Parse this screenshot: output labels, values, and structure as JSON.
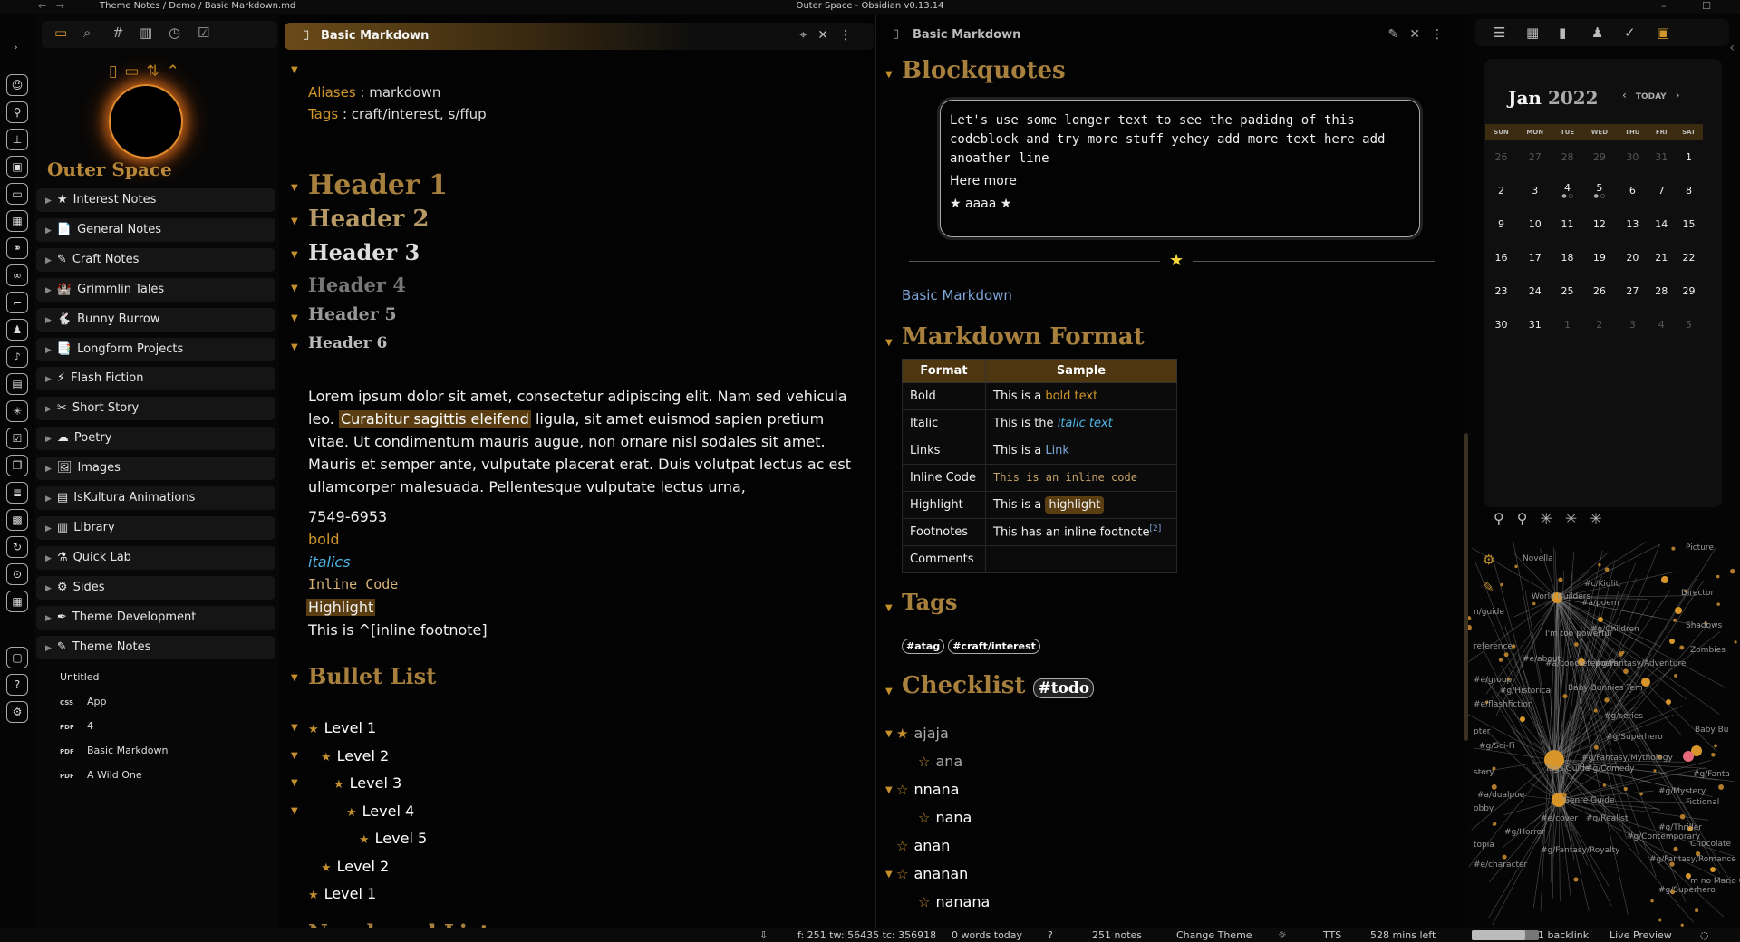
{
  "window": {
    "path": "Theme Notes / Demo / Basic Markdown.md",
    "title": "Outer Space - Obsidian v0.13.14",
    "controls": "– ☐"
  },
  "colors": {
    "accent": "#d0962a",
    "background": "#050505",
    "link": "#7ea6d9"
  },
  "left": {
    "vault_name": "Outer Space",
    "folders": [
      {
        "icon": "★",
        "label": "Interest Notes"
      },
      {
        "icon": "📄",
        "label": "General Notes"
      },
      {
        "icon": "✎",
        "label": "Craft Notes"
      },
      {
        "icon": "🏰",
        "label": "Grimmlin Tales"
      },
      {
        "icon": "🐇",
        "label": "Bunny Burrow"
      },
      {
        "icon": "📑",
        "label": "Longform Projects"
      },
      {
        "icon": "⚡",
        "label": "Flash Fiction"
      },
      {
        "icon": "✂",
        "label": "Short Story"
      },
      {
        "icon": "☁",
        "label": "Poetry"
      },
      {
        "icon": "🖼",
        "label": "Images"
      },
      {
        "icon": "▤",
        "label": "IsKultura Animations"
      },
      {
        "icon": "▥",
        "label": "Library"
      },
      {
        "icon": "⚗",
        "label": "Quick Lab"
      },
      {
        "icon": "⚙",
        "label": "Sides"
      },
      {
        "icon": "✒",
        "label": "Theme Development"
      },
      {
        "icon": "✎",
        "label": "Theme Notes"
      }
    ],
    "files": [
      {
        "badge": "",
        "label": "Untitled"
      },
      {
        "badge": "CSS",
        "label": "App"
      },
      {
        "badge": "PDF",
        "label": "4"
      },
      {
        "badge": "PDF",
        "label": "Basic Markdown"
      },
      {
        "badge": "PDF",
        "label": "A Wild One"
      }
    ]
  },
  "editor": {
    "tab_title": "Basic Markdown",
    "aliases_key": "Aliases",
    "aliases_val": " : markdown",
    "tags_key": "Tags",
    "tags_val": " : craft/interest, s/ffup",
    "headers": [
      "Header 1",
      "Header 2",
      "Header 3",
      "Header 4",
      "Header 5",
      "Header 6"
    ],
    "para_1": "Lorem ipsum dolor sit amet, consectetur adipiscing elit. Nam sed vehicula leo. ",
    "para_hl": "Curabitur sagittis eleifend",
    "para_2": " ligula, sit amet euismod sapien pretium vitae. Ut condimentum mauris augue, non ornare nisl sodales sit amet. Mauris et semper ante, vulputate placerat erat. Duis volutpat lectus ac est ullamcorper malesuada. Pellentesque vulputate lectus urna,",
    "phone": "7549-6953",
    "bold": "bold",
    "italics": "italics",
    "inline_code": "Inline Code",
    "highlight": "Highlight",
    "footnote": "This is ^[inline footnote]",
    "bullet_heading": "Bullet List",
    "bullets": [
      "Level 1",
      "Level 2",
      "Level 3",
      "Level 4",
      "Level 5",
      "Level 2",
      "Level 1"
    ],
    "next_heading": "Numbered List"
  },
  "preview": {
    "tab_title": "Basic Markdown",
    "blockquotes_heading": "Blockquotes",
    "quote_text": "Let's use some longer text to see the padidng of this codeblock and try more stuff yehey add more text here add anoather line",
    "quote_more": "Here more",
    "quote_star": "★ aaaa ★",
    "link_text": "Basic Markdown",
    "format_heading": "Markdown Format",
    "table_headers": [
      "Format",
      "Sample"
    ],
    "table_rows": [
      {
        "format": "Bold",
        "pre": "This is a ",
        "sample": "bold text"
      },
      {
        "format": "Italic",
        "pre": "This is the ",
        "sample": "italic text"
      },
      {
        "format": "Links",
        "pre": "This is a ",
        "sample": "Link"
      },
      {
        "format": "Inline Code",
        "pre": "",
        "sample": "This is an inline code"
      },
      {
        "format": "Highlight",
        "pre": "This is a ",
        "sample": "highlight"
      },
      {
        "format": "Footnotes",
        "pre": "This has an inline footnote",
        "sample": "[2]"
      },
      {
        "format": "Comments",
        "pre": "",
        "sample": ""
      }
    ],
    "tags_heading": "Tags",
    "tags": [
      "#atag",
      "#craft/interest"
    ],
    "checklist_heading": "Checklist",
    "checklist_tag": "#todo",
    "checklist": [
      "ajaja",
      "ana",
      "nnana",
      "nana",
      "anan",
      "ananan",
      "nanana"
    ]
  },
  "calendar": {
    "month": "Jan",
    "year": "2022",
    "today": "TODAY",
    "weekdays": [
      "SUN",
      "MON",
      "TUE",
      "WED",
      "THU",
      "FRI",
      "SAT"
    ],
    "weeks": [
      [
        "26",
        "27",
        "28",
        "29",
        "30",
        "31",
        "1"
      ],
      [
        "2",
        "3",
        "4",
        "5",
        "6",
        "7",
        "8"
      ],
      [
        "9",
        "10",
        "11",
        "12",
        "13",
        "14",
        "15"
      ],
      [
        "16",
        "17",
        "18",
        "19",
        "20",
        "21",
        "22"
      ],
      [
        "23",
        "24",
        "25",
        "26",
        "27",
        "28",
        "29"
      ],
      [
        "30",
        "31",
        "1",
        "2",
        "3",
        "4",
        "5"
      ]
    ]
  },
  "graph_labels": [
    "Picture",
    "Novella",
    "Director",
    "#c/Kidlit",
    "World Builders",
    "#a/poem",
    "n/guide",
    "I'm too powerful",
    "#g/Children",
    "Shadows",
    "Zombies",
    "reference",
    "#e/about",
    "#a/concretepoem",
    "#g/Fantasy/Adventure",
    "#e/group",
    "#g/Historical",
    "Baby Bunnies Tem",
    "#e/flashfiction",
    "#g/series",
    "pter",
    "#g/Sci-Fi",
    "Tags Guide",
    "#g/Superhero",
    "Baby Bu",
    "#g/Fantasy/Mythology",
    "story",
    "#g/Comedy",
    "#g/Fanta",
    "#a/dualpoe",
    "Genre Guide",
    "#g/Mystery",
    "obby",
    "#e/cover",
    "#g/Realist",
    "Fictional",
    "#g/Horror",
    "#g/Thriller",
    "topia",
    "#g/Contemporary",
    "Chocolate",
    "#g/Fantasy/Royalty",
    "#g/Fantasy/Romance",
    "#e/character",
    "I'm no Mario C",
    "#g/Superhero"
  ],
  "status": {
    "position": "f: 251 tw: 56435 tc: 356918",
    "words": "0 words today",
    "notes": "251 notes",
    "theme": "Change Theme",
    "tts": "TTS",
    "mins": "528 mins left",
    "progress": 0.8,
    "backlink": "1 backlink",
    "mode": "Live Preview"
  }
}
